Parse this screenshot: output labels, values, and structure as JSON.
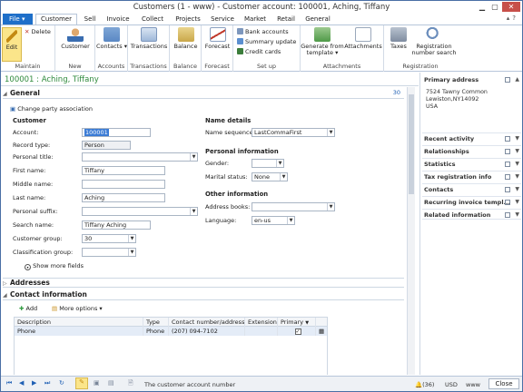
{
  "window": {
    "title": "Customers (1 - www) - Customer account: 100001, Aching, Tiffany"
  },
  "tabs": {
    "file": "File",
    "items": [
      "Customer",
      "Sell",
      "Invoice",
      "Collect",
      "Projects",
      "Service",
      "Market",
      "Retail",
      "General"
    ]
  },
  "ribbon": {
    "edit": "Edit",
    "delete": "Delete",
    "maintain": "Maintain",
    "customer": "Customer",
    "new": "New",
    "contacts": "Contacts",
    "accounts": "Accounts",
    "transactions": "Transactions",
    "transactions_group": "Transactions",
    "balance": "Balance",
    "balance_group": "Balance",
    "forecast": "Forecast",
    "forecast_group": "Forecast",
    "bank_accounts": "Bank accounts",
    "summary_update": "Summary update",
    "credit_cards": "Credit cards",
    "setup": "Set up",
    "generate_from_template": "Generate from template",
    "attachments": "Attachments",
    "attachments_group": "Attachments",
    "taxes": "Taxes",
    "registration_number_search": "Registration number search",
    "registration": "Registration"
  },
  "record": {
    "title": "100001 : Aching, Tiffany"
  },
  "general": {
    "header": "General",
    "count": "30",
    "change_party": "Change party association",
    "customer_group_title": "Customer",
    "account_label": "Account:",
    "account": "100001",
    "record_type_label": "Record type:",
    "record_type": "Person",
    "personal_title_label": "Personal title:",
    "personal_title": "",
    "first_name_label": "First name:",
    "first_name": "Tiffany",
    "middle_name_label": "Middle name:",
    "middle_name": "",
    "last_name_label": "Last name:",
    "last_name": "Aching",
    "personal_suffix_label": "Personal suffix:",
    "personal_suffix": "",
    "search_name_label": "Search name:",
    "search_name": "Tiffany Aching",
    "customer_group_label": "Customer group:",
    "customer_group": "30",
    "classification_group_label": "Classification group:",
    "classification_group": "",
    "show_more": "Show more fields",
    "name_details_title": "Name details",
    "name_sequence_label": "Name sequence:",
    "name_sequence": "LastCommaFirst",
    "personal_info_title": "Personal information",
    "gender_label": "Gender:",
    "gender": "",
    "marital_status_label": "Marital status:",
    "marital_status": "None",
    "other_info_title": "Other information",
    "address_books_label": "Address books:",
    "address_books": "",
    "language_label": "Language:",
    "language": "en-us"
  },
  "addresses": {
    "header": "Addresses"
  },
  "contact": {
    "header": "Contact information",
    "add": "Add",
    "more_options": "More options",
    "columns": [
      "Description",
      "Type",
      "Contact number/address",
      "Extension",
      "Primary"
    ],
    "rows": [
      {
        "description": "Phone",
        "type": "Phone",
        "number": "(207) 094-7102",
        "extension": "",
        "primary": true
      }
    ]
  },
  "factbox": {
    "primary_address": "Primary address",
    "address_lines": [
      "7524 Tawny Common",
      "Lewiston,NY14092",
      "USA"
    ],
    "sections": [
      "Recent activity",
      "Relationships",
      "Statistics",
      "Tax registration info",
      "Contacts",
      "Recurring invoice templ...",
      "Related information"
    ]
  },
  "statusbar": {
    "hint": "The customer account number",
    "notifications": "(36)",
    "currency": "USD",
    "company": "www",
    "close": "Close"
  }
}
